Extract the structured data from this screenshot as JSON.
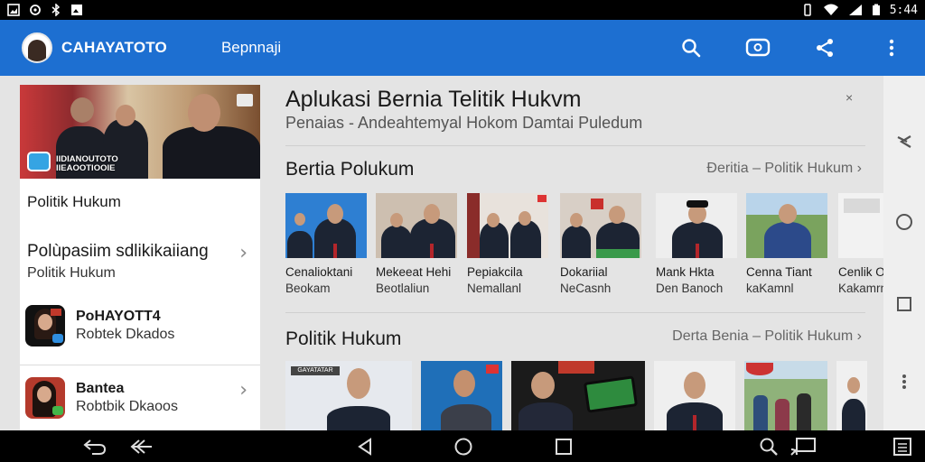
{
  "status_bar": {
    "time": "5:44"
  },
  "app_bar": {
    "brand": "CAHAYATOTO",
    "subtitle": "Bepnnaji",
    "actions": [
      "search-icon",
      "chat-icon",
      "share-icon",
      "more-vert-icon"
    ]
  },
  "sidebar": {
    "hero_caption_line1": "IIDIANOUTOTO",
    "hero_caption_line2": "IIEAOOTIOOIE",
    "item_politik": "Politik Hukum",
    "item_category_title": "Polùpasiim sdlikikaiiang",
    "item_category_sub": "Politik Hukum",
    "contact1_name": "PoHAYOTT4",
    "contact1_sub": "Robtek Dkados",
    "contact2_name": "Bantea",
    "contact2_sub": "Robtbik Dkaoos"
  },
  "main": {
    "title": "Aplukasi Bernia Telitik Hukvm",
    "subtitle": "Penaias - Andeahtemyal Hokom Damtai Puledum",
    "close": "×",
    "section1": {
      "title": "Bertia Polukum",
      "more": "Ɖeritia – Politik Hukum ›",
      "items": [
        {
          "line1": "Cenalioktani",
          "line2": "Beokam"
        },
        {
          "line1": "Mekeeat Hehi",
          "line2": "Beotlaliun"
        },
        {
          "line1": "Pepiakcila",
          "line2": "Nemallanl"
        },
        {
          "line1": "Dokariial",
          "line2": "NeCasnh"
        },
        {
          "line1": "Mank Hkta",
          "line2": "Den Banoch"
        },
        {
          "line1": "Cenna Tiant",
          "line2": "kaKamnl"
        },
        {
          "line1": "Cenlik Oi",
          "line2": "Kakamrn"
        }
      ]
    },
    "section2": {
      "title": "Politik Hukum",
      "more": "Derta Benia – Politik Hukum ›",
      "thumb_label": "GAYATATAR"
    }
  },
  "colors": {
    "app_bar": "#1d6fd1",
    "status_bar": "#000000",
    "nav_bar": "#000000",
    "panel": "#ffffff",
    "background": "#e4e4e4"
  },
  "nav_bar": {
    "icons": [
      "back-gesture-icon",
      "back-icon",
      "home-icon",
      "recents-icon",
      "search-icon",
      "cast-icon",
      "keyboard-icon"
    ]
  }
}
